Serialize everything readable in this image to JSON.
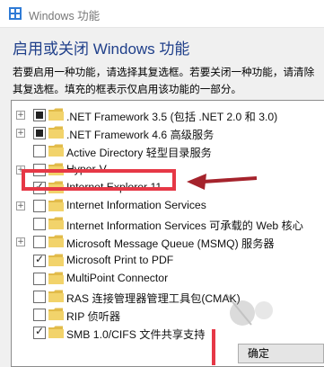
{
  "window": {
    "title": "Windows 功能"
  },
  "heading": "启用或关闭 Windows 功能",
  "description": "若要启用一种功能，请选择其复选框。若要关闭一种功能，请清除其复选框。填充的框表示仅启用该功能的一部分。",
  "features": [
    {
      "label": ".NET Framework 3.5 (包括 .NET 2.0 和 3.0)",
      "state": "partial",
      "expandable": true
    },
    {
      "label": ".NET Framework 4.6 高级服务",
      "state": "partial",
      "expandable": true
    },
    {
      "label": "Active Directory 轻型目录服务",
      "state": "unchecked",
      "expandable": false
    },
    {
      "label": "Hyper-V",
      "state": "unchecked",
      "expandable": true
    },
    {
      "label": "Internet Explorer 11",
      "state": "checked",
      "expandable": false
    },
    {
      "label": "Internet Information Services",
      "state": "unchecked",
      "expandable": true
    },
    {
      "label": "Internet Information Services 可承载的 Web 核心",
      "state": "unchecked",
      "expandable": false
    },
    {
      "label": "Microsoft Message Queue (MSMQ) 服务器",
      "state": "unchecked",
      "expandable": true
    },
    {
      "label": "Microsoft Print to PDF",
      "state": "checked",
      "expandable": false
    },
    {
      "label": "MultiPoint Connector",
      "state": "unchecked",
      "expandable": false
    },
    {
      "label": "RAS 连接管理器管理工具包(CMAK)",
      "state": "unchecked",
      "expandable": false
    },
    {
      "label": "RIP 侦听器",
      "state": "unchecked",
      "expandable": false
    },
    {
      "label": "SMB 1.0/CIFS 文件共享支持",
      "state": "checked",
      "expandable": false
    }
  ],
  "buttons": {
    "ok": "确定"
  },
  "colors": {
    "heading": "#1f3f8a",
    "highlight": "#e63846",
    "folder": "#f2d36b"
  }
}
